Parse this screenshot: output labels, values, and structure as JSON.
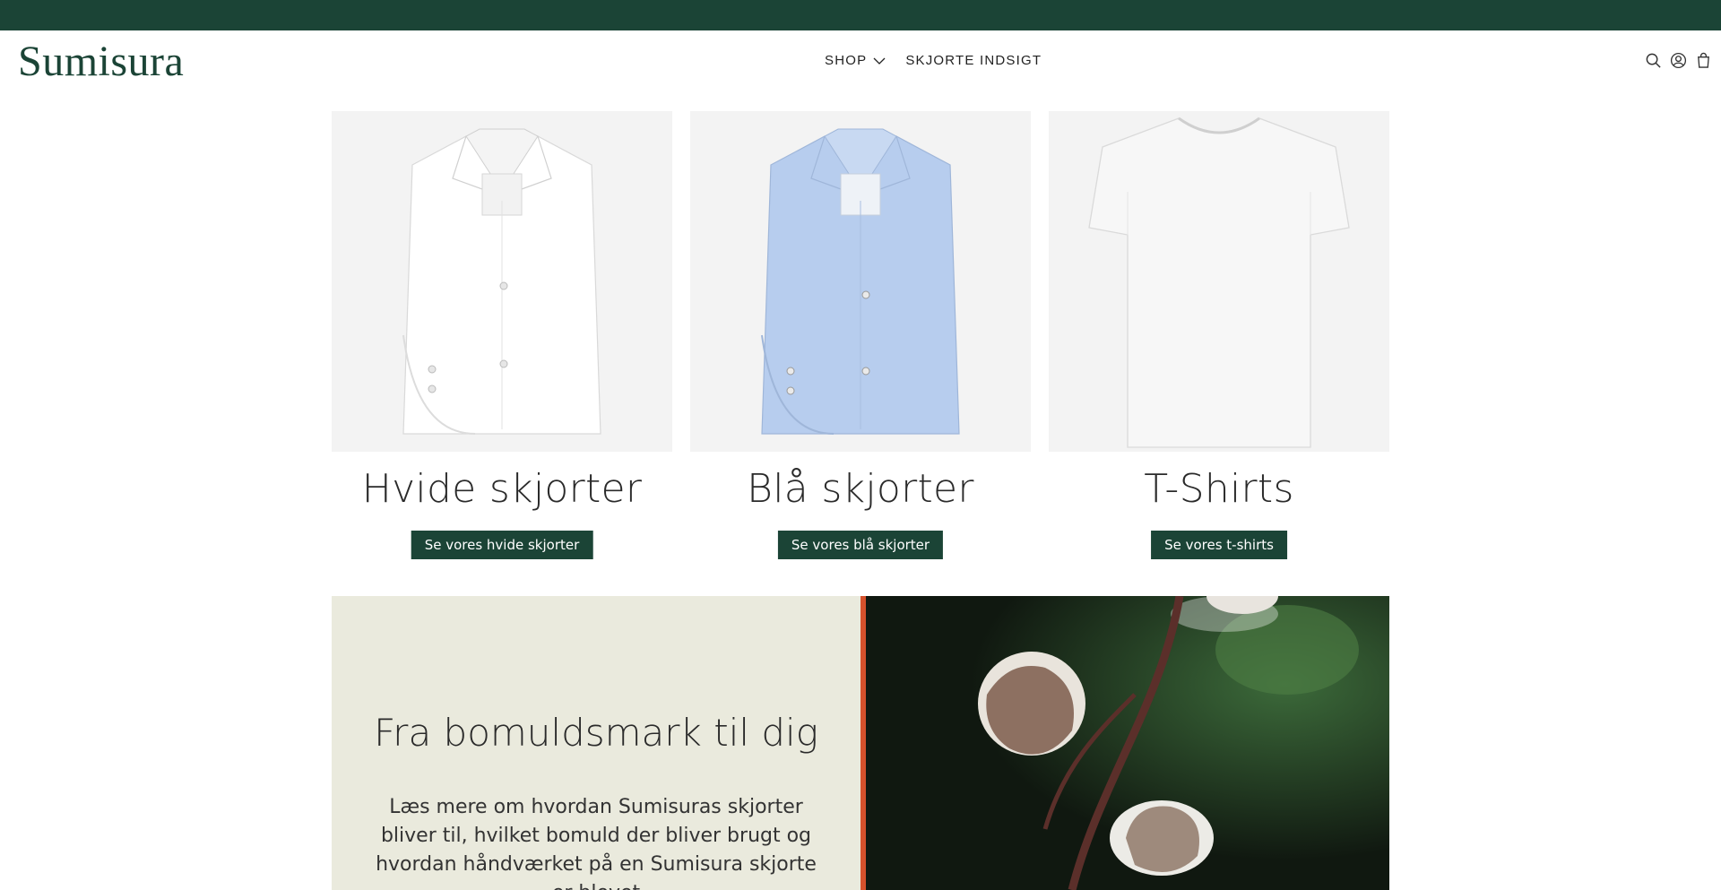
{
  "colors": {
    "brand": "#1b4436",
    "accent": "#d5512c",
    "panel": "#eaeadd"
  },
  "header": {
    "logo": "Sumisura",
    "nav": [
      {
        "label": "SHOP",
        "icon": "chevron-down-icon"
      },
      {
        "label": "SKJORTE INDSIGT"
      }
    ],
    "icons": [
      "search-icon",
      "account-icon",
      "cart-icon"
    ]
  },
  "products": [
    {
      "title": "Hvide skjorter",
      "button": "Se vores hvide skjorter",
      "image": "white-shirt"
    },
    {
      "title": "Blå skjorter",
      "button": "Se vores blå skjorter",
      "image": "blue-shirt"
    },
    {
      "title": "T-Shirts",
      "button": "Se vores t-shirts",
      "image": "white-tshirt"
    }
  ],
  "story": {
    "title": "Fra bomuldsmark til dig",
    "text": "Læs mere om hvordan Sumisuras skjorter bliver til, hvilket bomuld der bliver brugt og hvordan håndværket på en Sumisura skjorte er blevet",
    "image": "cotton-plant-photo"
  }
}
